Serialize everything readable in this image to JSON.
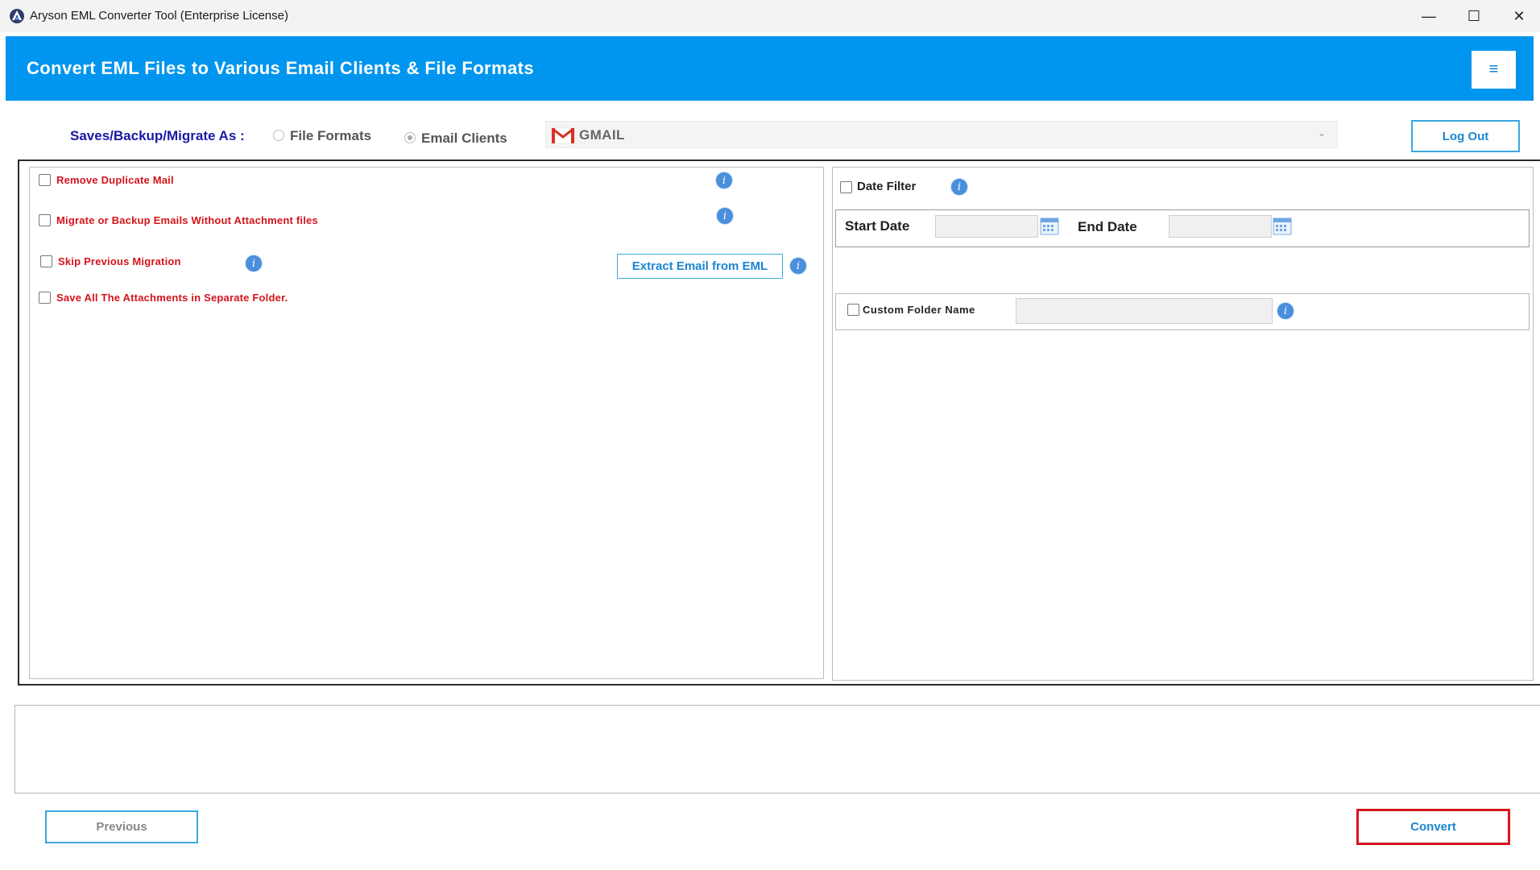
{
  "window": {
    "title": "Aryson EML Converter Tool (Enterprise License)",
    "minimize_glyph": "—",
    "maximize_glyph": "☐",
    "close_glyph": "✕"
  },
  "header": {
    "title": "Convert EML Files to Various Email Clients & File Formats",
    "menu_glyph": "≡"
  },
  "saves": {
    "label": "Saves/Backup/Migrate As :",
    "options": [
      {
        "label": "File Formats",
        "selected": false
      },
      {
        "label": "Email Clients",
        "selected": true
      }
    ],
    "client_select": {
      "value": "GMAIL",
      "icon": "gmail-icon",
      "arrow": "⌄"
    },
    "logout_label": "Log Out"
  },
  "left_options": {
    "items": [
      {
        "label": "Remove Duplicate Mail",
        "checked": false
      },
      {
        "label": "Migrate or Backup Emails Without Attachment files",
        "checked": false
      },
      {
        "label": "Skip Previous Migration",
        "checked": false
      },
      {
        "label": "Save All The Attachments in Separate Folder.",
        "checked": false
      }
    ],
    "extract_button": "Extract Email from EML"
  },
  "right_options": {
    "date_filter_label": "Date Filter",
    "start_date_label": "Start Date",
    "end_date_label": "End Date",
    "start_date_value": "",
    "end_date_value": "",
    "custom_folder_label": "Custom Folder Name",
    "custom_folder_value": ""
  },
  "info_glyph": "i",
  "footer": {
    "previous_label": "Previous",
    "convert_label": "Convert"
  },
  "colors": {
    "header_bg": "#0095ee",
    "accent_blue": "#1a86d0",
    "option_red": "#d4141c",
    "convert_border": "#d8141f",
    "saves_label": "#1a19a6"
  }
}
